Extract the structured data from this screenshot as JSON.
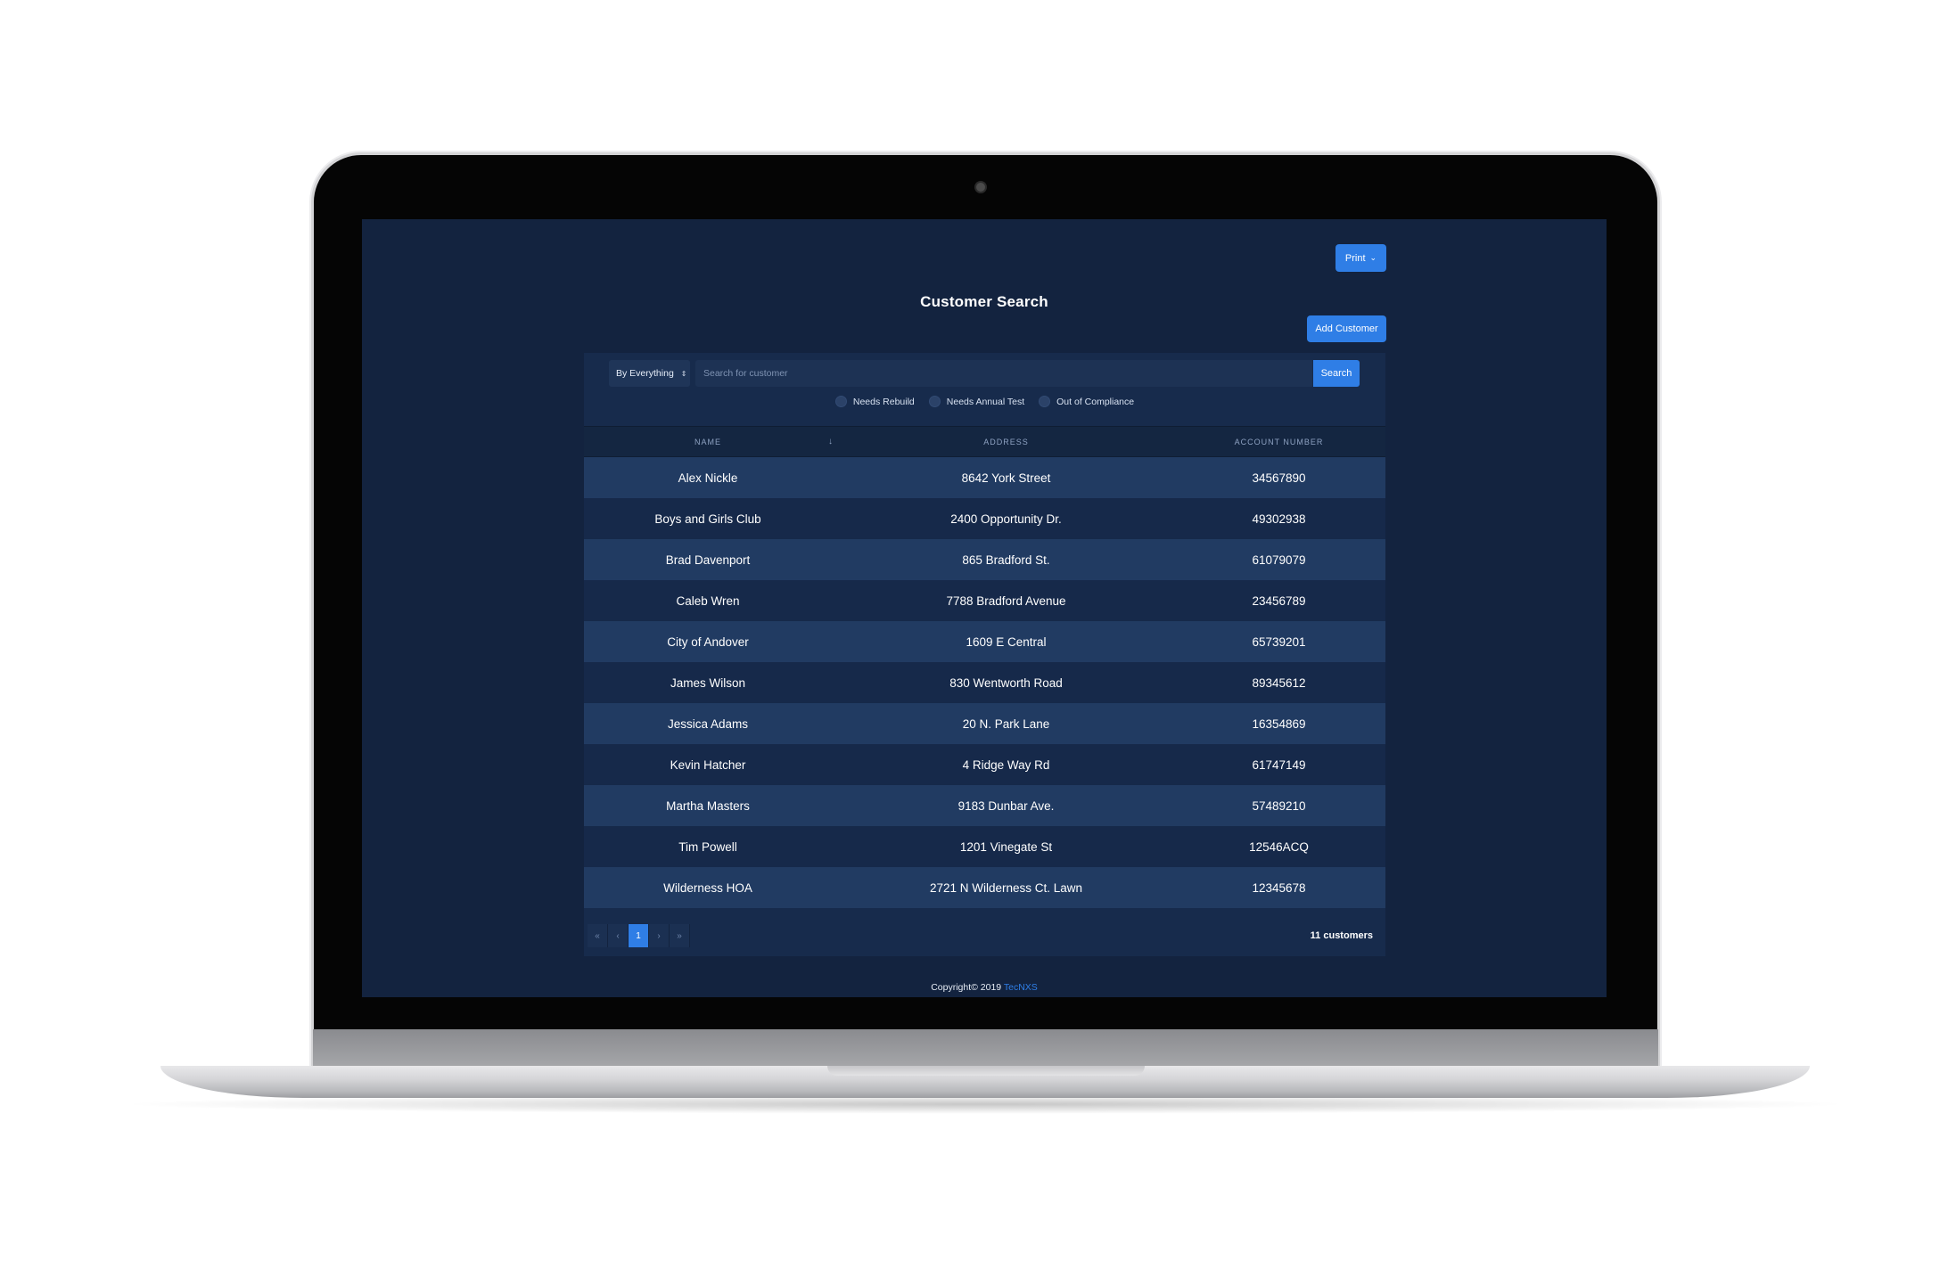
{
  "toolbar": {
    "print_label": "Print",
    "add_customer_label": "Add Customer"
  },
  "page": {
    "title": "Customer Search"
  },
  "search": {
    "filter_value": "By Everything",
    "placeholder": "Search for customer",
    "button_label": "Search"
  },
  "filters": [
    {
      "label": "Needs Rebuild"
    },
    {
      "label": "Needs Annual Test"
    },
    {
      "label": "Out of Compliance"
    }
  ],
  "table": {
    "columns": {
      "name": "NAME",
      "address": "ADDRESS",
      "account": "ACCOUNT NUMBER"
    },
    "sort_indicator": "↓",
    "rows": [
      {
        "name": "Alex Nickle",
        "address": "8642 York Street",
        "account": "34567890"
      },
      {
        "name": "Boys and Girls Club",
        "address": "2400 Opportunity Dr.",
        "account": "49302938"
      },
      {
        "name": "Brad Davenport",
        "address": "865 Bradford St.",
        "account": "61079079"
      },
      {
        "name": "Caleb Wren",
        "address": "7788 Bradford Avenue",
        "account": "23456789"
      },
      {
        "name": "City of Andover",
        "address": "1609 E Central",
        "account": "65739201"
      },
      {
        "name": "James Wilson",
        "address": "830 Wentworth Road",
        "account": "89345612"
      },
      {
        "name": "Jessica Adams",
        "address": "20 N. Park Lane",
        "account": "16354869"
      },
      {
        "name": "Kevin Hatcher",
        "address": "4 Ridge Way Rd",
        "account": "61747149"
      },
      {
        "name": "Martha Masters",
        "address": "9183 Dunbar Ave.",
        "account": "57489210"
      },
      {
        "name": "Tim Powell",
        "address": "1201 Vinegate St",
        "account": "12546ACQ"
      },
      {
        "name": "Wilderness HOA",
        "address": "2721 N Wilderness Ct. Lawn",
        "account": "12345678"
      }
    ]
  },
  "pagination": {
    "first": "«",
    "prev": "‹",
    "current": "1",
    "next": "›",
    "last": "»",
    "count_label": "11 customers"
  },
  "footer": {
    "copyright": "Copyright© 2019",
    "brand": "TecNXS"
  },
  "colors": {
    "accent": "#2f7ee6",
    "background": "#13233f",
    "row_alt": "#213b62"
  }
}
